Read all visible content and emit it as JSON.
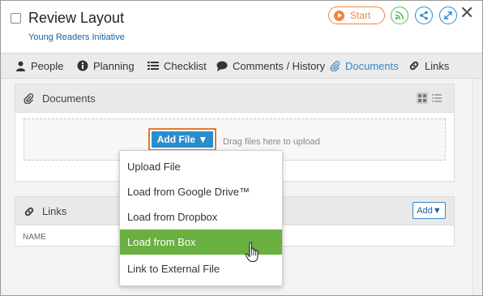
{
  "header": {
    "title": "Review Layout",
    "subtitle": "Young Readers Initiative",
    "start_label": "Start",
    "buttons": [
      "rss-icon",
      "share-icon",
      "expand-icon"
    ],
    "accent_orange": "#f0843a",
    "accent_green": "#5cb85c",
    "accent_blue": "#2a8ccd"
  },
  "tabs": [
    {
      "label": "People",
      "icon": "person-icon"
    },
    {
      "label": "Planning",
      "icon": "info-icon"
    },
    {
      "label": "Checklist",
      "icon": "list-icon"
    },
    {
      "label": "Comments / History",
      "icon": "comment-icon"
    },
    {
      "label": "Documents",
      "icon": "paperclip-icon",
      "active": true
    },
    {
      "label": "Links",
      "icon": "link-icon"
    }
  ],
  "documents": {
    "title": "Documents",
    "add_file_label": "Add File ▼",
    "drop_text": "Drag files here to upload"
  },
  "links": {
    "title": "Links",
    "add_label": "Add▼",
    "column_name": "NAME"
  },
  "menu": {
    "items": [
      {
        "label": "Upload File"
      },
      {
        "label": "Load from Google Drive™"
      },
      {
        "label": "Load from Dropbox"
      },
      {
        "label": "Load from Box",
        "highlighted": true
      },
      {
        "label": "Link to External File"
      }
    ]
  }
}
